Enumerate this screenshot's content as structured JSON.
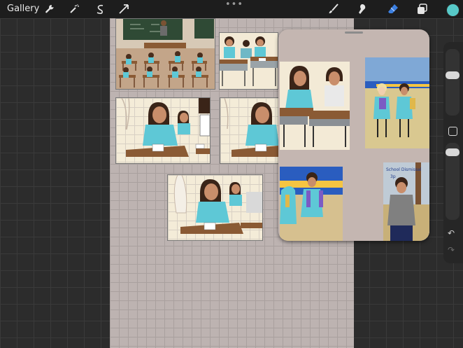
{
  "toolbar": {
    "gallery_label": "Gallery",
    "more_label": "•••",
    "current_color": "#57c9c8",
    "left_icons": [
      "wrench-icon",
      "magic-wand-icon",
      "selection-icon",
      "transform-arrow-icon"
    ],
    "right_icons": [
      "brush-icon",
      "smudge-icon",
      "eraser-icon",
      "layers-icon"
    ]
  },
  "sidebar": {
    "undo_icon": "↶",
    "redo_icon": "↷"
  },
  "reference": {
    "sign_text": "School Dismissal",
    "sign_sub": "3p"
  }
}
